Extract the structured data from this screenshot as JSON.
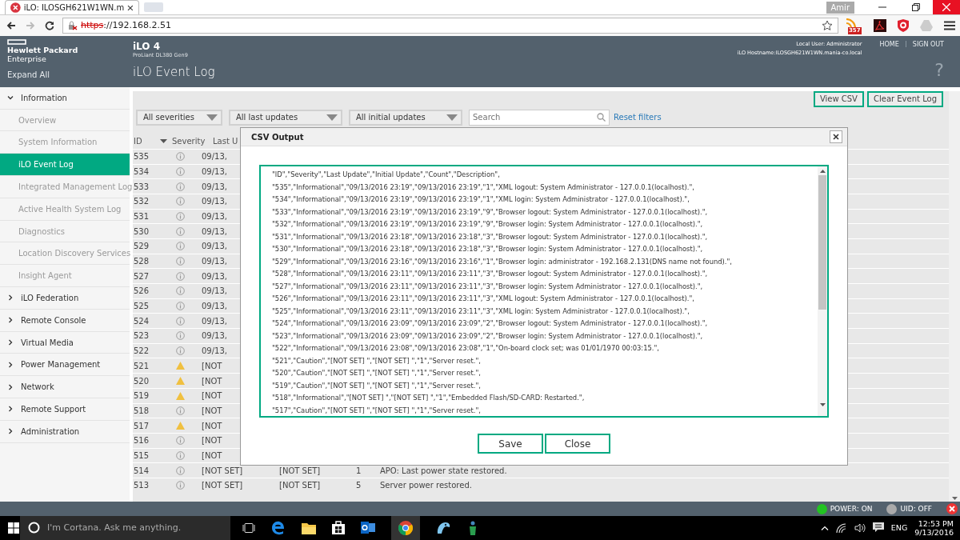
{
  "browser": {
    "tab_title": "iLO: ILOSGH621W1WN.m",
    "address_scheme": "https",
    "address_rest": "://192.168.2.51",
    "profile": "Amir",
    "extension_badge": "357"
  },
  "header": {
    "brand_line1": "Hewlett Packard",
    "brand_line2": "Enterprise",
    "product": "iLO 4",
    "model": "ProLiant DL380 Gen9",
    "local_user": "Local User:  Administrator",
    "hostname": "iLO Hostname:ILOSGH621W1WN.mania-co.local",
    "links": [
      "HOME",
      "SIGN OUT"
    ],
    "help": "?",
    "expand_all": "Expand All",
    "page_title": "iLO Event Log"
  },
  "sidebar": {
    "items": [
      {
        "label": "Information",
        "expanded": true,
        "children": [
          {
            "label": "Overview",
            "selected": false
          },
          {
            "label": "System Information",
            "selected": false
          },
          {
            "label": "iLO Event Log",
            "selected": true
          },
          {
            "label": "Integrated Management Log",
            "selected": false
          },
          {
            "label": "Active Health System Log",
            "selected": false
          },
          {
            "label": "Diagnostics",
            "selected": false
          },
          {
            "label": "Location Discovery Services",
            "selected": false
          },
          {
            "label": "Insight Agent",
            "selected": false
          }
        ]
      },
      {
        "label": "iLO Federation",
        "expanded": false
      },
      {
        "label": "Remote Console",
        "expanded": false
      },
      {
        "label": "Virtual Media",
        "expanded": false
      },
      {
        "label": "Power Management",
        "expanded": false
      },
      {
        "label": "Network",
        "expanded": false
      },
      {
        "label": "Remote Support",
        "expanded": false
      },
      {
        "label": "Administration",
        "expanded": false
      }
    ]
  },
  "toolbar": {
    "buttons": [
      "View CSV",
      "Clear Event Log"
    ]
  },
  "filters": {
    "dropdowns": [
      "All severities",
      "All last updates",
      "All initial updates"
    ],
    "search": {
      "placeholder": "Search"
    },
    "reset": "Reset filters"
  },
  "table": {
    "columns": [
      "ID",
      "Severity",
      "Last U"
    ],
    "rows": [
      {
        "id": "535",
        "kind": "info",
        "last_update": "09/13,"
      },
      {
        "id": "534",
        "kind": "info",
        "last_update": "09/13,"
      },
      {
        "id": "533",
        "kind": "info",
        "last_update": "09/13,"
      },
      {
        "id": "532",
        "kind": "info",
        "last_update": "09/13,"
      },
      {
        "id": "531",
        "kind": "info",
        "last_update": "09/13,"
      },
      {
        "id": "530",
        "kind": "info",
        "last_update": "09/13,"
      },
      {
        "id": "529",
        "kind": "info",
        "last_update": "09/13,"
      },
      {
        "id": "528",
        "kind": "info",
        "last_update": "09/13,"
      },
      {
        "id": "527",
        "kind": "info",
        "last_update": "09/13,"
      },
      {
        "id": "526",
        "kind": "info",
        "last_update": "09/13,"
      },
      {
        "id": "525",
        "kind": "info",
        "last_update": "09/13,"
      },
      {
        "id": "524",
        "kind": "info",
        "last_update": "09/13,"
      },
      {
        "id": "523",
        "kind": "info",
        "last_update": "09/13,"
      },
      {
        "id": "522",
        "kind": "info",
        "last_update": "09/13,"
      },
      {
        "id": "521",
        "kind": "caution",
        "last_update": "[NOT"
      },
      {
        "id": "520",
        "kind": "caution",
        "last_update": "[NOT"
      },
      {
        "id": "519",
        "kind": "caution",
        "last_update": "[NOT"
      },
      {
        "id": "518",
        "kind": "info",
        "last_update": "[NOT"
      },
      {
        "id": "517",
        "kind": "caution",
        "last_update": "[NOT"
      },
      {
        "id": "516",
        "kind": "info",
        "last_update": "[NOT"
      },
      {
        "id": "515",
        "kind": "info",
        "last_update": "[NOT"
      },
      {
        "id": "514",
        "kind": "info",
        "last_update": "[NOT SET]",
        "initial_update": "[NOT SET]",
        "count": "1",
        "description": "APO: Last power state restored."
      },
      {
        "id": "513",
        "kind": "info",
        "last_update": "[NOT SET]",
        "initial_update": "[NOT SET]",
        "count": "5",
        "description": "Server power restored."
      }
    ]
  },
  "dialog": {
    "title": "CSV Output",
    "lines": [
      "\"ID\",\"Severity\",\"Last Update\",\"Initial Update\",\"Count\",\"Description\",",
      "\"535\",\"Informational\",\"09/13/2016 23:19\",\"09/13/2016 23:19\",\"1\",\"XML logout: System Administrator - 127.0.0.1(localhost).\",",
      "\"534\",\"Informational\",\"09/13/2016 23:19\",\"09/13/2016 23:19\",\"1\",\"XML login: System Administrator - 127.0.0.1(localhost).\",",
      "\"533\",\"Informational\",\"09/13/2016 23:19\",\"09/13/2016 23:19\",\"9\",\"Browser logout: System Administrator - 127.0.0.1(localhost).\",",
      "\"532\",\"Informational\",\"09/13/2016 23:19\",\"09/13/2016 23:19\",\"9\",\"Browser login: System Administrator - 127.0.0.1(localhost).\",",
      "\"531\",\"Informational\",\"09/13/2016 23:18\",\"09/13/2016 23:18\",\"3\",\"Browser logout: System Administrator - 127.0.0.1(localhost).\",",
      "\"530\",\"Informational\",\"09/13/2016 23:18\",\"09/13/2016 23:18\",\"3\",\"Browser login: System Administrator - 127.0.0.1(localhost).\",",
      "\"529\",\"Informational\",\"09/13/2016 23:16\",\"09/13/2016 23:16\",\"1\",\"Browser login: administrator - 192.168.2.131(DNS name not found).\",",
      "\"528\",\"Informational\",\"09/13/2016 23:11\",\"09/13/2016 23:11\",\"3\",\"Browser logout: System Administrator - 127.0.0.1(localhost).\",",
      "\"527\",\"Informational\",\"09/13/2016 23:11\",\"09/13/2016 23:11\",\"3\",\"Browser login: System Administrator - 127.0.0.1(localhost).\",",
      "\"526\",\"Informational\",\"09/13/2016 23:11\",\"09/13/2016 23:11\",\"3\",\"XML logout: System Administrator - 127.0.0.1(localhost).\",",
      "\"525\",\"Informational\",\"09/13/2016 23:11\",\"09/13/2016 23:11\",\"3\",\"XML login: System Administrator - 127.0.0.1(localhost).\",",
      "\"524\",\"Informational\",\"09/13/2016 23:09\",\"09/13/2016 23:09\",\"2\",\"Browser logout: System Administrator - 127.0.0.1(localhost).\",",
      "\"523\",\"Informational\",\"09/13/2016 23:09\",\"09/13/2016 23:09\",\"2\",\"Browser login: System Administrator - 127.0.0.1(localhost).\",",
      "\"522\",\"Informational\",\"09/13/2016 23:08\",\"09/13/2016 23:08\",\"1\",\"On-board clock set; was 01/01/1970  00:03:15.\",",
      "\"521\",\"Caution\",\"[NOT SET] \",\"[NOT SET] \",\"1\",\"Server reset.\",",
      "\"520\",\"Caution\",\"[NOT SET] \",\"[NOT SET] \",\"1\",\"Server reset.\",",
      "\"519\",\"Caution\",\"[NOT SET] \",\"[NOT SET] \",\"1\",\"Server reset.\",",
      "\"518\",\"Informational\",\"[NOT SET] \",\"[NOT SET] \",\"1\",\"Embedded Flash/SD-CARD: Restarted.\",",
      "\"517\",\"Caution\",\"[NOT SET] \",\"[NOT SET] \",\"1\",\"Server reset.\","
    ],
    "buttons": [
      "Save",
      "Close"
    ]
  },
  "status_bar": {
    "power": "POWER: ON",
    "uid": "UID: OFF"
  },
  "taskbar": {
    "search_placeholder": "I'm Cortana. Ask me anything.",
    "language": "ENG",
    "time": "12:53 PM",
    "date": "9/13/2016"
  }
}
